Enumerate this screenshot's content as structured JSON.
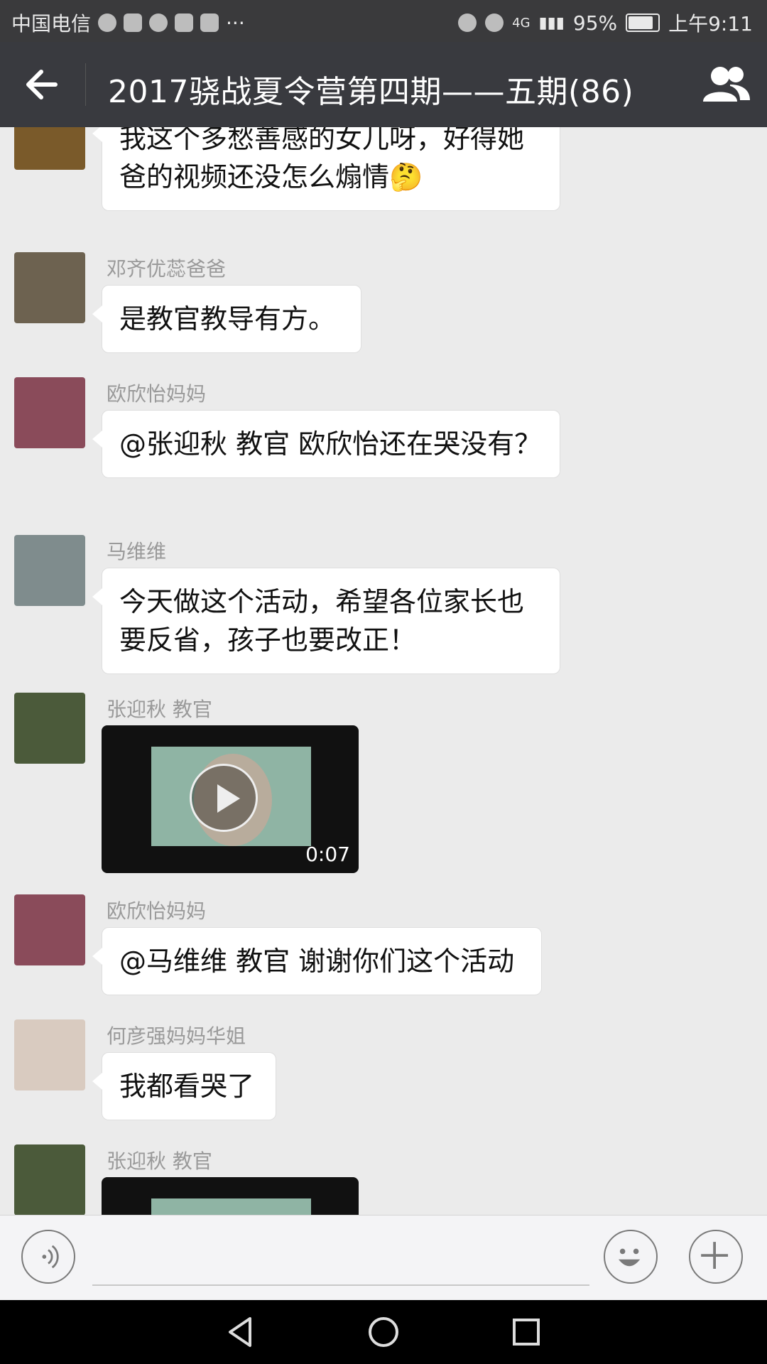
{
  "status_bar": {
    "carrier": "中国电信",
    "extra": "···",
    "network": "4G",
    "battery_percent": "95%",
    "battery_level": 0.95,
    "time": "上午9:11"
  },
  "header": {
    "title": "2017骁战夏令营第四期——五期(86)",
    "back_icon": "back-arrow-icon",
    "members_icon": "group-members-icon"
  },
  "messages": [
    {
      "sender": "",
      "text": "我这个多愁善感的女儿呀，好得她爸的视频还没怎么煽情🤔",
      "avatar_color": "#7a5a2a"
    },
    {
      "sender": "邓齐优蕊爸爸",
      "text": "是教官教导有方。",
      "avatar_color": "#6d6250"
    },
    {
      "sender": "欧欣怡妈妈",
      "text": "@张迎秋 教官 欧欣怡还在哭没有？",
      "avatar_color": "#8a4b5a"
    },
    {
      "sender": "马维维",
      "text": "今天做这个活动，希望各位家长也要反省，孩子也要改正！",
      "avatar_color": "#7f8c8d"
    },
    {
      "sender": "张迎秋 教官",
      "video_duration": "0:07",
      "avatar_color": "#4b5a3a"
    },
    {
      "sender": "欧欣怡妈妈",
      "text": "@马维维 教官 谢谢你们这个活动",
      "avatar_color": "#8a4b5a"
    },
    {
      "sender": "何彦强妈妈华姐",
      "text": "我都看哭了",
      "avatar_color": "#d9cbc0"
    },
    {
      "sender": "张迎秋 教官",
      "avatar_color": "#4b5a3a"
    }
  ],
  "input_bar": {
    "voice_icon": "voice-icon",
    "emoji_icon": "emoji-icon",
    "plus_icon": "plus-icon"
  }
}
